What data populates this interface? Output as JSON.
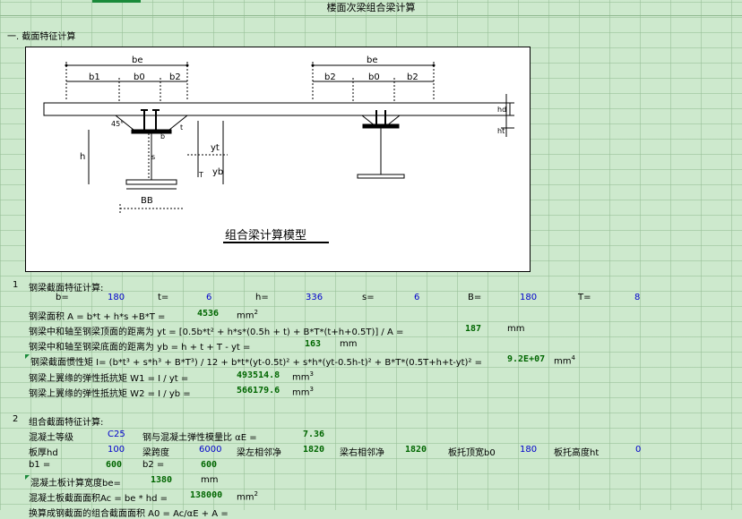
{
  "title": "楼面次梁组合梁计算",
  "section1": {
    "heading": "一. 截面特征计算"
  },
  "figure": {
    "labels": {
      "be1": "be",
      "b1": "b1",
      "b0a": "b0",
      "b2a": "b2",
      "be2": "be",
      "b2b": "b2",
      "b0b": "b0",
      "b2c": "b2",
      "hd": "hd",
      "ht": "ht",
      "h": "h",
      "yt": "yt",
      "yb": "yb",
      "T": "T",
      "s": "s",
      "t": "t",
      "BB": "BB",
      "deg": "45°",
      "bside": "b"
    },
    "caption": "组合梁计算模型"
  },
  "steel": {
    "num": "1",
    "heading": "钢梁截面特征计算:",
    "params": {
      "b_label": "b=",
      "b": "180",
      "t_label": "t=",
      "t": "6",
      "h_label": "h=",
      "h": "336",
      "s_label": "s=",
      "s": "6",
      "B_label": "B=",
      "B": "180",
      "T_label": "T=",
      "T": "8"
    },
    "area_label": "钢梁面积  A = b*t + h*s +B*T =",
    "area": "4536",
    "area_unit": "mm",
    "yt_label": "钢梁中和轴至钢梁顶面的距离为 yt = [0.5b*t² + h*s*(0.5h + t) + B*T*(t+h+0.5T)] / A =",
    "yt": "187",
    "yt_unit": "mm",
    "yb_label": "钢梁中和轴至钢梁底面的距离为 yb = h + t + T - yt =",
    "yb": "163",
    "yb_unit": "mm",
    "I_label": "钢梁截面惯性矩 I= (b*t³ + s*h³ + B*T³) / 12 + b*t*(yt-0.5t)² + s*h*(yt-0.5h-t)² + B*T*(0.5T+h+t-yt)² =",
    "I": "9.2E+07",
    "I_unit": "mm",
    "W1_label": "钢梁上翼缘的弹性抵抗矩 W1 = I / yt =",
    "W1": "493514.8",
    "W1_unit": "mm",
    "W2_label": "钢梁上翼缘的弹性抵抗矩 W2 = I / yb =",
    "W2": "566179.6",
    "W2_unit": "mm"
  },
  "composite": {
    "num": "2",
    "heading": "组合截面特征计算:",
    "concrete_label": "混凝土等级",
    "concrete": "C25",
    "ratio_label": "钢与混凝土弹性模量比 αE =",
    "ratio": "7.36",
    "hd_label": "板厚hd",
    "hd": "100",
    "span_label": "梁跨度",
    "span": "6000",
    "left_label": "梁左相邻净",
    "left": "1820",
    "right_label": "梁右相邻净",
    "right": "1820",
    "b0_label": "板托顶宽b0",
    "b0": "180",
    "ht_label": "板托高度ht",
    "ht": "0",
    "b1_label": "b1 =",
    "b1": "600",
    "b2_label": "b2 =",
    "b2": "600",
    "be_label": "混凝土板计算宽度be=",
    "be": "1380",
    "be_unit": "mm",
    "Ac_label": "混凝土板截面面积Ac = be * hd =",
    "Ac": "138000",
    "Ac_unit": "mm",
    "cut_label": "换算成钢截面的组合截面面积 A0 = Ac/αE + A ="
  }
}
